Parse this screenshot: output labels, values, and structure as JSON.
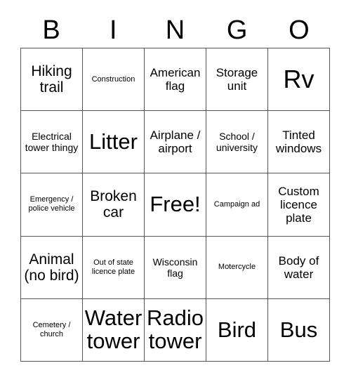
{
  "card": {
    "title": "BINGO",
    "header_letters": [
      "B",
      "I",
      "N",
      "G",
      "O"
    ],
    "grid_size": "5x5",
    "free_space_label": "Free!",
    "colors": {
      "border": "#555555",
      "cell_background": "#ffffff",
      "text": "#000000",
      "page_background": "#ffffff"
    },
    "rows": [
      {
        "cells": [
          {
            "label": "Hiking trail",
            "size": "lg"
          },
          {
            "label": "Construction",
            "size": "xs"
          },
          {
            "label": "American flag",
            "size": "md"
          },
          {
            "label": "Storage unit",
            "size": "md"
          },
          {
            "label": "Rv",
            "size": "huge"
          }
        ]
      },
      {
        "cells": [
          {
            "label": "Electrical tower thingy",
            "size": "sm"
          },
          {
            "label": "Litter",
            "size": "xxl"
          },
          {
            "label": "Airplane / airport",
            "size": "md"
          },
          {
            "label": "School / university",
            "size": "sm"
          },
          {
            "label": "Tinted windows",
            "size": "md"
          }
        ]
      },
      {
        "cells": [
          {
            "label": "Emergency / police vehicle",
            "size": "xs"
          },
          {
            "label": "Broken car",
            "size": "lg"
          },
          {
            "label": "Free!",
            "size": "xxl"
          },
          {
            "label": "Campaign ad",
            "size": "xs"
          },
          {
            "label": "Custom licence plate",
            "size": "md"
          }
        ]
      },
      {
        "cells": [
          {
            "label": "Animal (no bird)",
            "size": "lg"
          },
          {
            "label": "Out of state licence plate",
            "size": "xs"
          },
          {
            "label": "Wisconsin flag",
            "size": "sm"
          },
          {
            "label": "Motercycle",
            "size": "xs"
          },
          {
            "label": "Body of water",
            "size": "md"
          }
        ]
      },
      {
        "cells": [
          {
            "label": "Cemetery / church",
            "size": "xs"
          },
          {
            "label": "Water tower",
            "size": "xxl"
          },
          {
            "label": "Radio tower",
            "size": "xxl"
          },
          {
            "label": "Bird",
            "size": "xxl"
          },
          {
            "label": "Bus",
            "size": "xxl"
          }
        ]
      }
    ]
  }
}
